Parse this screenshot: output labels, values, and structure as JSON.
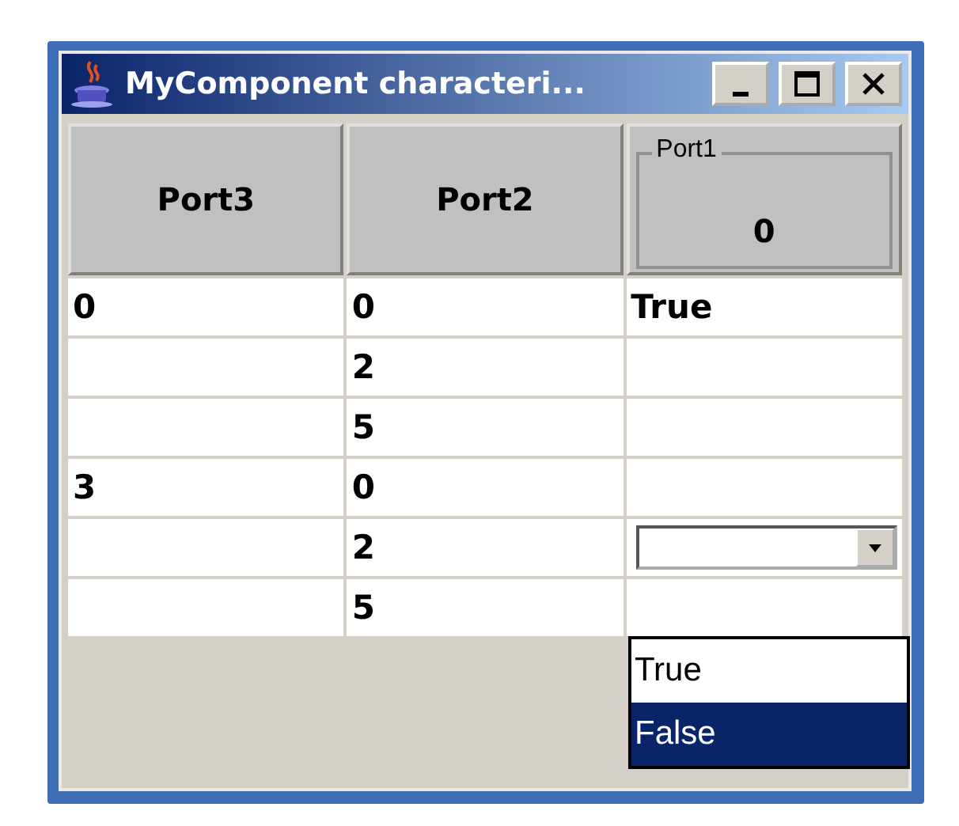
{
  "window": {
    "title": "MyComponent characteri..."
  },
  "columns": [
    {
      "kind": "plain",
      "label": "Port3"
    },
    {
      "kind": "plain",
      "label": "Port2"
    },
    {
      "kind": "titled",
      "label": "Port1",
      "value": "0"
    }
  ],
  "rows": [
    {
      "port3": "0",
      "port2": "0",
      "port1": "True",
      "editing": false
    },
    {
      "port2": "2",
      "editing": false
    },
    {
      "port2": "5",
      "editing": false
    },
    {
      "port3": "3",
      "port2": "0",
      "editing": false
    },
    {
      "port2": "2",
      "editing": true
    },
    {
      "port2": "5",
      "editing": false
    }
  ],
  "dropdown": {
    "options": [
      {
        "label": "True",
        "selected": false
      },
      {
        "label": "False",
        "selected": true
      }
    ]
  }
}
